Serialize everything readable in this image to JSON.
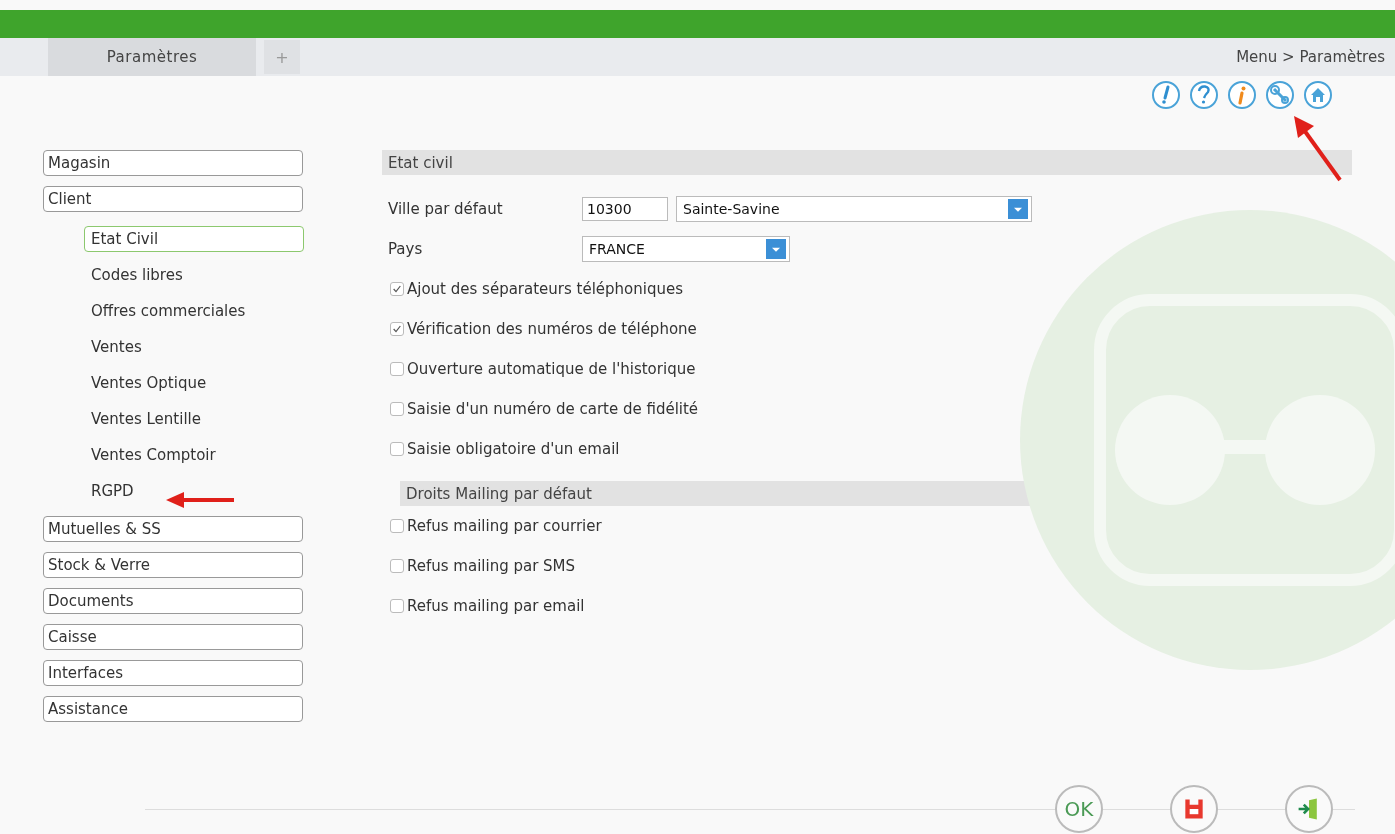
{
  "tabs": [
    {
      "label": "Paramètres",
      "selected": true
    }
  ],
  "add_tab": "+",
  "breadcrumb": "Menu > Paramètres",
  "sidebar": {
    "items": [
      {
        "label": "Magasin"
      },
      {
        "label": "Client",
        "children": [
          {
            "label": "Etat Civil",
            "selected": true
          },
          {
            "label": "Codes libres",
            "selected": false
          },
          {
            "label": "Offres commerciales",
            "selected": false
          },
          {
            "label": "Ventes",
            "selected": false
          },
          {
            "label": "Ventes Optique",
            "selected": false
          },
          {
            "label": "Ventes Lentille",
            "selected": false
          },
          {
            "label": "Ventes Comptoir",
            "selected": false
          },
          {
            "label": "RGPD",
            "selected": false
          }
        ]
      },
      {
        "label": "Mutuelles & SS"
      },
      {
        "label": "Stock & Verre"
      },
      {
        "label": "Documents"
      },
      {
        "label": "Caisse"
      },
      {
        "label": "Interfaces"
      },
      {
        "label": "Assistance"
      }
    ]
  },
  "sections": [
    {
      "title": "Etat civil",
      "rows": [
        {
          "kind": "city",
          "label": "Ville par défaut",
          "postcode": "10300",
          "value": "Sainte-Savine"
        },
        {
          "kind": "select",
          "label": "Pays",
          "value": "FRANCE"
        },
        {
          "kind": "checkbox",
          "label": "Ajout des séparateurs téléphoniques",
          "checked": true
        },
        {
          "kind": "checkbox",
          "label": "Vérification des numéros de téléphone",
          "checked": true
        },
        {
          "kind": "checkbox",
          "label": "Ouverture automatique de l'historique",
          "checked": false
        },
        {
          "kind": "checkbox",
          "label": "Saisie d'un numéro de carte de fidélité",
          "checked": false
        },
        {
          "kind": "checkbox",
          "label": "Saisie obligatoire d'un email",
          "checked": false
        }
      ]
    },
    {
      "title": "Droits Mailing par défaut",
      "rows": [
        {
          "kind": "checkbox",
          "label": "Refus mailing par courrier",
          "checked": false
        },
        {
          "kind": "checkbox",
          "label": "Refus mailing par SMS",
          "checked": false
        },
        {
          "kind": "checkbox",
          "label": "Refus mailing par email",
          "checked": false
        }
      ]
    }
  ],
  "footer": {
    "ok_label": "OK"
  }
}
